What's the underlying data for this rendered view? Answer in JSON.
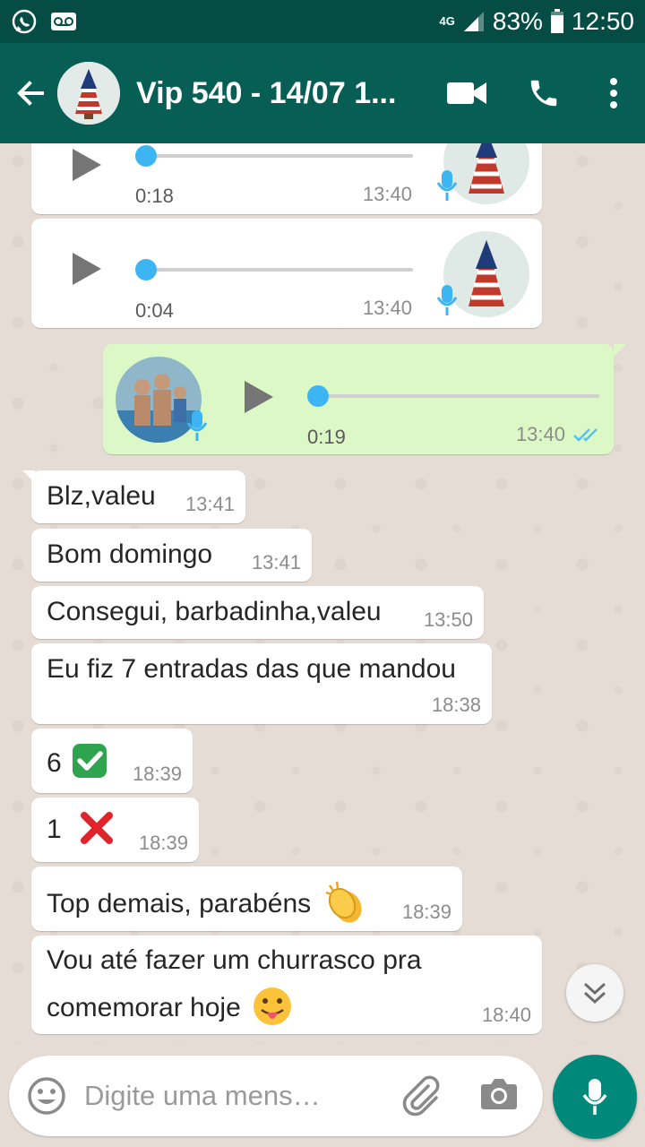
{
  "status_bar": {
    "network": "4G",
    "battery": "83%",
    "time": "12:50"
  },
  "header": {
    "title": "Vip 540 - 14/07 1..."
  },
  "voice_messages": [
    {
      "duration": "0:18",
      "time": "13:40",
      "direction": "incoming"
    },
    {
      "duration": "0:04",
      "time": "13:40",
      "direction": "incoming"
    },
    {
      "duration": "0:19",
      "time": "13:40",
      "direction": "outgoing",
      "status": "read"
    }
  ],
  "messages": [
    {
      "text": "Blz,valeu",
      "time": "13:41"
    },
    {
      "text": "Bom domingo",
      "time": "13:41"
    },
    {
      "text": "Consegui, barbadinha,valeu",
      "time": "13:50"
    },
    {
      "text": "Eu fiz 7 entradas das que mandou",
      "time": "18:38"
    },
    {
      "text": "6",
      "emoji": "check-mark-button",
      "time": "18:39"
    },
    {
      "text": "1",
      "emoji": "cross-mark",
      "time": "18:39"
    },
    {
      "text": "Top demais, parabéns",
      "emoji": "clapping-hands",
      "time": "18:39"
    },
    {
      "text_line1": "Vou até fazer um churrasco pra",
      "text_line2": "comemorar hoje",
      "emoji": "face-with-tongue",
      "time": "18:40"
    }
  ],
  "input": {
    "placeholder": "Digite uma mens…"
  },
  "colors": {
    "status_bar": "#054d44",
    "app_bar": "#075e54",
    "outgoing_bubble": "#dcf8c6",
    "incoming_bubble": "#ffffff",
    "chat_background": "#e5ddd5",
    "fab": "#00897b",
    "read_ticks": "#4fc3f7",
    "seek_knob": "#3cb5f2"
  }
}
